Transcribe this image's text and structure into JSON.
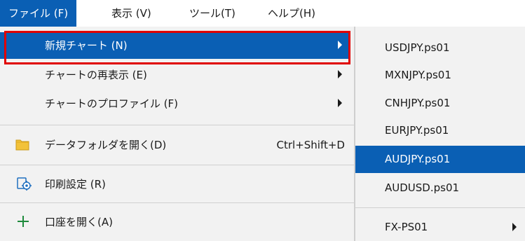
{
  "menubar": {
    "items": [
      {
        "label": "ファイル (F)"
      },
      {
        "label": "表示 (V)"
      },
      {
        "label": "ツール(T)"
      },
      {
        "label": "ヘルプ(H)"
      }
    ]
  },
  "file_menu": {
    "items": [
      {
        "label": "新規チャート (N)",
        "has_submenu": true
      },
      {
        "label": "チャートの再表示 (E)",
        "has_submenu": true
      },
      {
        "label": "チャートのプロファイル (F)",
        "has_submenu": true
      },
      {
        "label": "データフォルダを開く(D)",
        "shortcut": "Ctrl+Shift+D",
        "icon": "folder-icon"
      },
      {
        "label": "印刷設定 (R)",
        "icon": "print-setup-icon"
      },
      {
        "label": "口座を開く(A)",
        "icon": "plus-icon"
      }
    ]
  },
  "submenu": {
    "items": [
      {
        "label": "USDJPY.ps01"
      },
      {
        "label": "MXNJPY.ps01"
      },
      {
        "label": "CNHJPY.ps01"
      },
      {
        "label": "EURJPY.ps01"
      },
      {
        "label": "AUDJPY.ps01"
      },
      {
        "label": "AUDUSD.ps01"
      },
      {
        "label": "FX-PS01",
        "has_submenu": true
      }
    ]
  },
  "colors": {
    "selection": "#0a5fb4",
    "highlight_box": "#e00000",
    "folder_icon": "#f2c23a",
    "plus_icon": "#1e8a3c"
  }
}
